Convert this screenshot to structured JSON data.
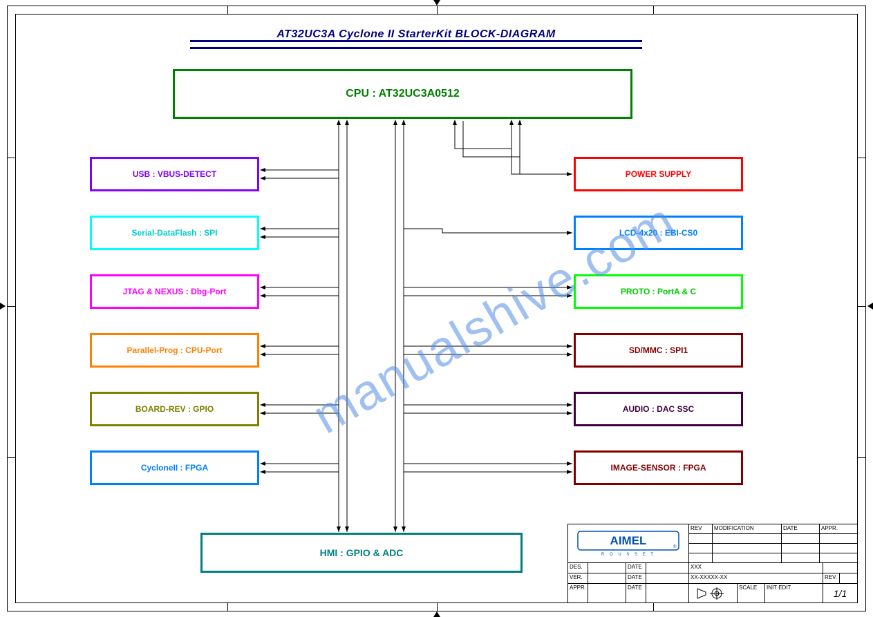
{
  "title": "AT32UC3A Cyclone II StarterKit  BLOCK-DIAGRAM",
  "cpu": "CPU  :  AT32UC3A0512",
  "left_boxes": [
    {
      "cls": "b-usb",
      "label": "USB : VBUS-DETECT"
    },
    {
      "cls": "b-serial",
      "label": "Serial-DataFlash : SPI"
    },
    {
      "cls": "b-jtag",
      "label": "JTAG & NEXUS : Dbg-Port"
    },
    {
      "cls": "b-prog",
      "label": "Parallel-Prog : CPU-Port"
    },
    {
      "cls": "b-rev",
      "label": "BOARD-REV : GPIO"
    },
    {
      "cls": "b-cycii",
      "label": "CycloneII : FPGA"
    }
  ],
  "right_boxes": [
    {
      "cls": "b-power",
      "label": "POWER SUPPLY"
    },
    {
      "cls": "b-lcd",
      "label": "LCD-4x20 : EBI-CS0"
    },
    {
      "cls": "b-proto",
      "label": "PROTO : PortA & C"
    },
    {
      "cls": "b-mmc",
      "label": "SD/MMC : SPI1"
    },
    {
      "cls": "b-audio",
      "label": "AUDIO : DAC SSC"
    },
    {
      "cls": "b-image",
      "label": "IMAGE-SENSOR : FPGA"
    }
  ],
  "bottom": "HMI : GPIO & ADC",
  "watermark": "manualshive.com",
  "titleblock": {
    "logo_sub": "R  O  U  S  S  E  T",
    "rows_top": [
      [
        "REV",
        "MODIFICATION",
        "DATE",
        "APPR."
      ],
      [
        "",
        "",
        "",
        ""
      ],
      [
        "",
        "",
        "",
        ""
      ],
      [
        "",
        "",
        "",
        ""
      ]
    ],
    "bot_labels": {
      "des": "DES.",
      "ver": "VER.",
      "appr": "APPR.",
      "date": "DATE",
      "proj_a": "XXX",
      "proj_b": "XX-XXXXX-XX",
      "scale": "SCALE",
      "sheet": "1/1",
      "rev": "REV.",
      "init": "INIT  EDIT"
    }
  }
}
